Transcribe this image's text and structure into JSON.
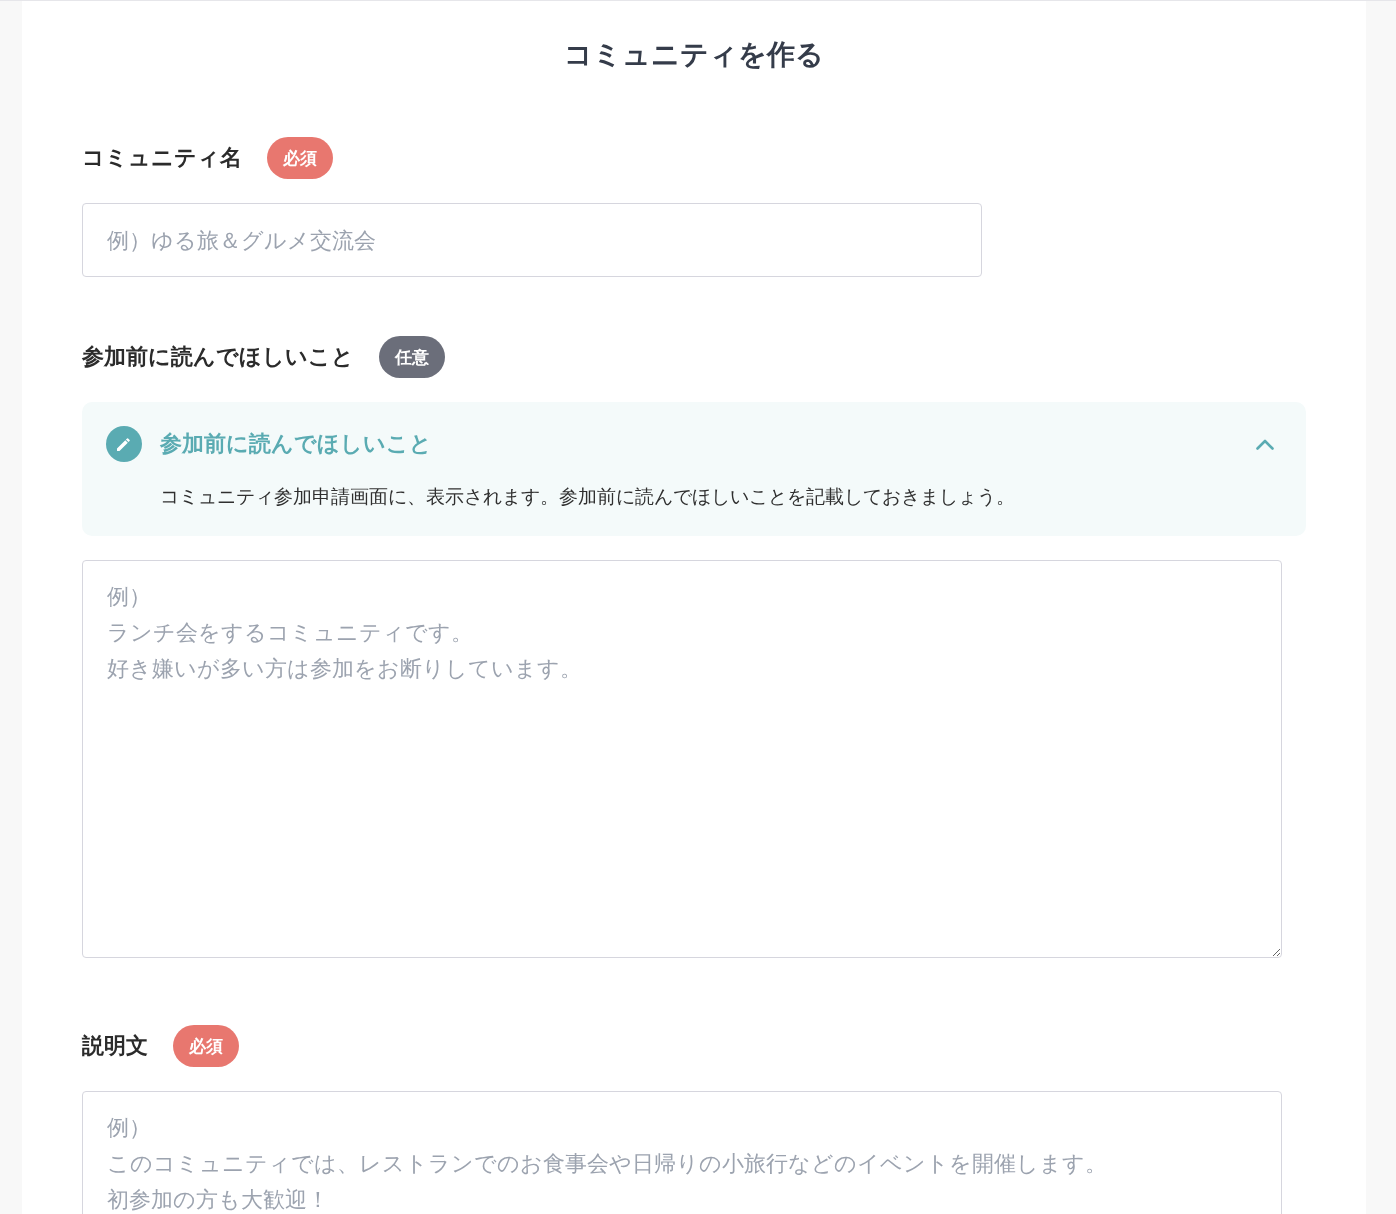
{
  "page": {
    "title": "コミュニティを作る"
  },
  "fields": [
    {
      "label": "コミュニティ名",
      "badge": {
        "text": "必須",
        "kind": "required"
      },
      "kind": "input",
      "placeholder": "例）ゆる旅＆グルメ交流会"
    },
    {
      "label": "参加前に読んでほしいこと",
      "badge": {
        "text": "任意",
        "kind": "optional"
      },
      "help": {
        "title": "参加前に読んでほしいこと",
        "body": "コミュニティ参加申請画面に、表示されます。参加前に読んでほしいことを記載しておきましょう。",
        "expanded": true
      },
      "kind": "textarea",
      "placeholder": [
        "例）",
        "ランチ会をするコミュニティです。",
        "好き嫌いが多い方は参加をお断りしています。"
      ]
    },
    {
      "label": "説明文",
      "badge": {
        "text": "必須",
        "kind": "required"
      },
      "kind": "textarea",
      "placeholder": [
        "例）",
        "このコミュニティでは、レストランでのお食事会や日帰りの小旅行などのイベントを開催します。",
        "初参加の方も大歓迎！"
      ]
    }
  ]
}
